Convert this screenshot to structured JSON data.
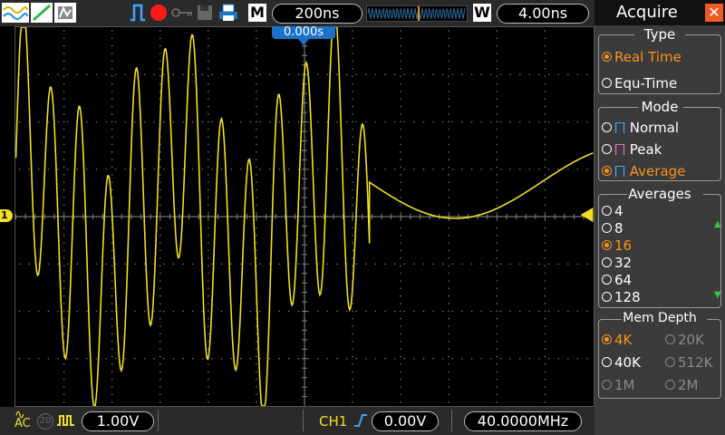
{
  "toolbar": {
    "timebase": "200ns",
    "memory_mode": "M",
    "window_mode": "W",
    "window_value": "4.00ns"
  },
  "trigger_position_label": "0.000s",
  "channel_marker": "1",
  "bottom": {
    "coupling": "AC",
    "bandwidth_limit": "20",
    "ch1_volts": "1.00V",
    "trigger_source": "CH1",
    "trigger_level": "0.00V",
    "frequency": "40.0000MHz"
  },
  "panel": {
    "title": "Acquire",
    "type": {
      "header": "Type",
      "options": [
        {
          "label": "Real Time",
          "selected": true
        },
        {
          "label": "Equ-Time",
          "selected": false
        }
      ]
    },
    "mode": {
      "header": "Mode",
      "options": [
        {
          "label": "Normal",
          "selected": false
        },
        {
          "label": "Peak",
          "selected": false
        },
        {
          "label": "Average",
          "selected": true
        }
      ]
    },
    "averages": {
      "header": "Averages",
      "options": [
        {
          "label": "4",
          "selected": false
        },
        {
          "label": "8",
          "selected": false
        },
        {
          "label": "16",
          "selected": true
        },
        {
          "label": "32",
          "selected": false
        },
        {
          "label": "64",
          "selected": false
        },
        {
          "label": "128",
          "selected": false
        }
      ]
    },
    "mem_depth": {
      "header": "Mem Depth",
      "options": [
        {
          "label": "4K",
          "selected": true
        },
        {
          "label": "20K",
          "selected": false
        },
        {
          "label": "40K",
          "selected": false
        },
        {
          "label": "512K",
          "selected": false
        },
        {
          "label": "1M",
          "selected": false
        },
        {
          "label": "2M",
          "selected": false
        }
      ]
    }
  },
  "colors": {
    "trace": "#f0e020",
    "accent": "#f7941d",
    "waveform_bg": "#000000"
  }
}
